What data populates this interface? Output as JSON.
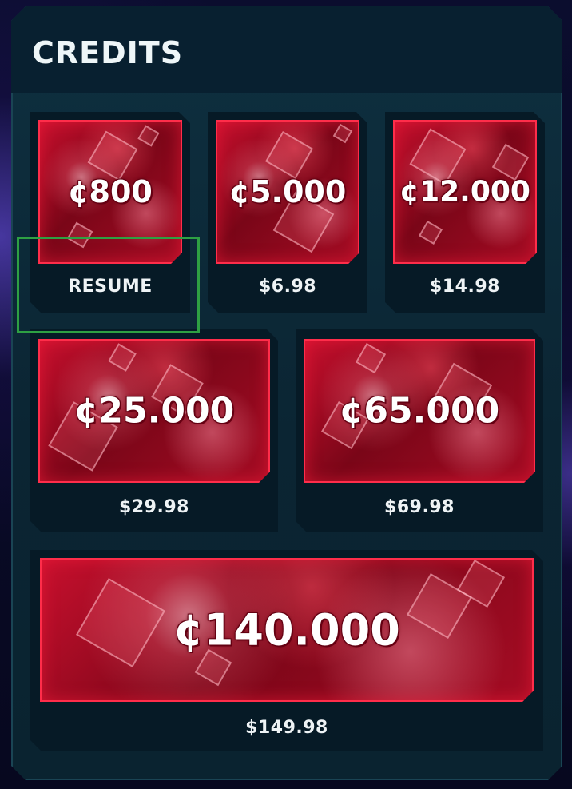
{
  "panel": {
    "title": "CREDITS"
  },
  "packs": [
    {
      "amount": "¢800",
      "price": "RESUME"
    },
    {
      "amount": "¢5.000",
      "price": "$6.98"
    },
    {
      "amount": "¢12.000",
      "price": "$14.98"
    },
    {
      "amount": "¢25.000",
      "price": "$29.98"
    },
    {
      "amount": "¢65.000",
      "price": "$69.98"
    },
    {
      "amount": "¢140.000",
      "price": "$149.98"
    }
  ],
  "colors": {
    "accent_red": "#c8102e",
    "panel_bg": "#0b2533",
    "focus_outline": "#2ea043"
  },
  "icons": [
    "cube-art"
  ]
}
